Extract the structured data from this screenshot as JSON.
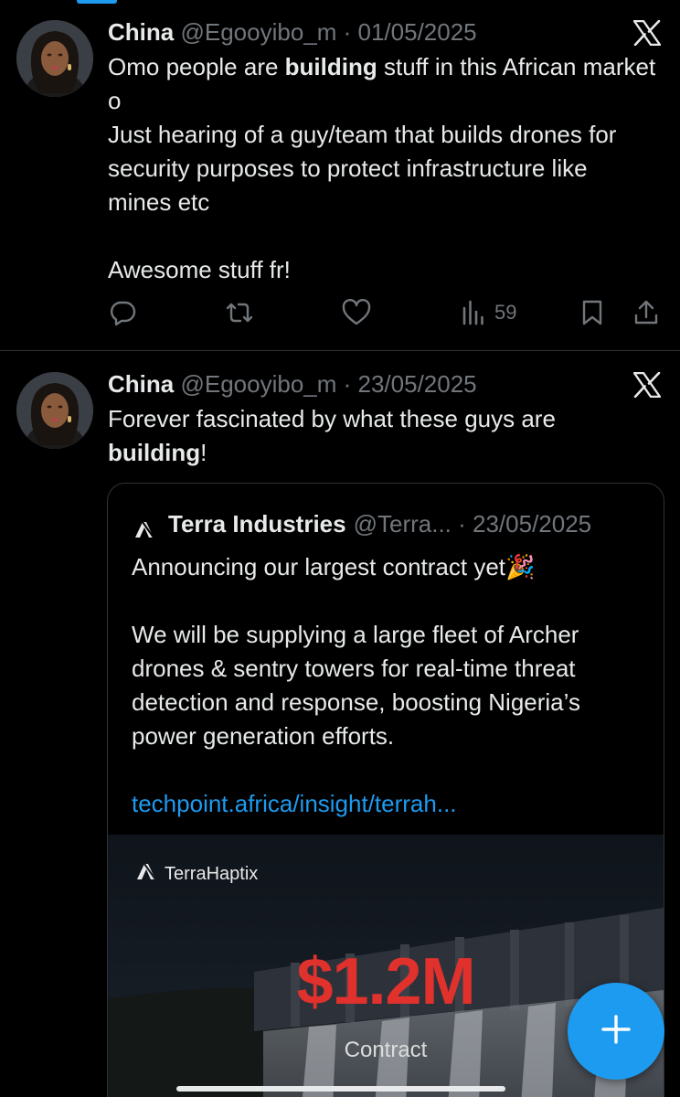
{
  "tweets": [
    {
      "author_name": "China",
      "author_meta": "@Egooyibo_m · 01/05/2025",
      "text_line1_pre": "Omo people are ",
      "text_line1_bold": "building",
      "text_line1_post": " stuff in this African market o",
      "text_line2": "Just hearing of a guy/team that builds drones for security purposes to protect infrastructure like mines etc",
      "text_line3": "Awesome stuff fr!",
      "views": "59"
    },
    {
      "author_name": "China",
      "author_meta": "@Egooyibo_m · 23/05/2025",
      "text_pre": "Forever fascinated by what these guys are ",
      "text_bold": "building",
      "text_post": "!"
    }
  ],
  "quote": {
    "author_name": "Terra Industries",
    "author_meta": "@Terra... · 23/05/2025",
    "text_line1": "Announcing our largest contract yet🎉",
    "text_line2": "We will be supplying a large fleet of Archer drones & sentry towers for real-time threat detection and response, boosting Nigeria’s power generation efforts.",
    "link": "techpoint.africa/insight/terrah...",
    "media": {
      "brand": "TerraHaptix",
      "amount": "$1.2M",
      "caption": "Contract"
    }
  },
  "colors": {
    "background": "#000000",
    "text": "#e7e9ea",
    "muted": "#71767b",
    "accent": "#1d9bf0",
    "amount_red": "#e0312d"
  },
  "icons": [
    "x-logo-icon",
    "reply-icon",
    "retweet-icon",
    "like-icon",
    "views-icon",
    "bookmark-icon",
    "share-icon",
    "terra-logo-icon",
    "plus-icon"
  ]
}
